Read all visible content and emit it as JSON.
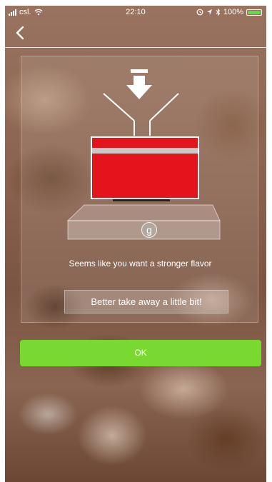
{
  "status_bar": {
    "carrier": "csl.",
    "time": "22:10",
    "battery": "100%"
  },
  "nav": {
    "back_icon": "chevron-left-icon"
  },
  "card": {
    "badge_letter": "g",
    "message": "Seems like you want a stronger flavor",
    "hint": "Better take away a little bit!"
  },
  "ok_button": {
    "label": "OK"
  },
  "colors": {
    "accent_green": "#79d930",
    "cup_red": "#e3141c",
    "cup_stripe": "#c9c9c9"
  },
  "icons": [
    "down-arrow-icon",
    "funnel-icon",
    "scale-icon",
    "coffee-cup-icon",
    "wifi-icon",
    "bluetooth-icon",
    "location-icon",
    "alarm-icon"
  ]
}
